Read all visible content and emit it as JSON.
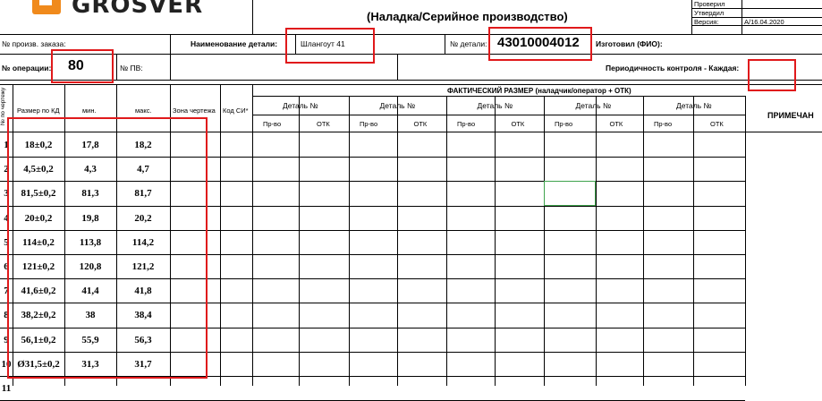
{
  "header": {
    "logo_text": "GROSVER",
    "title": "(Наладка/Серийное производство)",
    "checked_label": "Проверил",
    "approved_label": "Утвердил",
    "version_label": "Версия:",
    "version_value": "А/16.04.2020"
  },
  "fields": {
    "order_label": "№ произв. заказа:",
    "part_name_label": "Наименование детали:",
    "part_name_value": "Шлангоут 41",
    "part_no_label": "№ детали:",
    "part_no_value": "43010004012",
    "made_by_label": "Изготовил (ФИО):",
    "operation_label": "№ операции:",
    "operation_value": "80",
    "pv_label": "№ ПВ:",
    "periodicity_label": "Периодичность контроля - Каждая:"
  },
  "table": {
    "col_num": "№ по чертежу",
    "col_size": "Размер по КД",
    "col_min": "мин.",
    "col_max": "макс.",
    "col_zone": "Зона чертежа",
    "col_si": "Код СИ*",
    "actual_header": "ФАКТИЧЕСКИЙ РАЗМЕР (наладчик/оператор + ОТК)",
    "detail_label": "Деталь №",
    "prod_label": "Пр-во",
    "otk_label": "ОТК",
    "notes_label": "ПРИМЕЧАН",
    "rows": [
      {
        "n": "1",
        "size": "18±0,2",
        "min": "17,8",
        "max": "18,2"
      },
      {
        "n": "2",
        "size": "4,5±0,2",
        "min": "4,3",
        "max": "4,7"
      },
      {
        "n": "3",
        "size": "81,5±0,2",
        "min": "81,3",
        "max": "81,7"
      },
      {
        "n": "4",
        "size": "20±0,2",
        "min": "19,8",
        "max": "20,2"
      },
      {
        "n": "5",
        "size": "114±0,2",
        "min": "113,8",
        "max": "114,2"
      },
      {
        "n": "6",
        "size": "121±0,2",
        "min": "120,8",
        "max": "121,2"
      },
      {
        "n": "7",
        "size": "41,6±0,2",
        "min": "41,4",
        "max": "41,8"
      },
      {
        "n": "8",
        "size": "38,2±0,2",
        "min": "38",
        "max": "38,4"
      },
      {
        "n": "9",
        "size": "56,1±0,2",
        "min": "55,9",
        "max": "56,3"
      },
      {
        "n": "10",
        "size": "Ø31,5±0,2",
        "min": "31,3",
        "max": "31,7"
      },
      {
        "n": "11",
        "size": "",
        "min": "",
        "max": ""
      }
    ]
  }
}
